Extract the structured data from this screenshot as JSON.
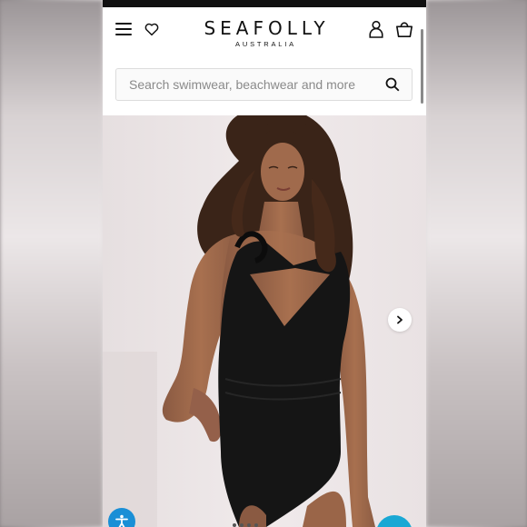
{
  "brand": {
    "name": "SEAFOLLY",
    "subtitle": "AUSTRALIA"
  },
  "search": {
    "placeholder": "Search swimwear, beachwear and more"
  },
  "icons": {
    "menu": "hamburger-menu-icon",
    "wishlist": "heart-icon",
    "account": "user-icon",
    "cart": "shopping-bag-icon",
    "search": "search-icon",
    "next": "chevron-right-icon",
    "accessibility": "accessibility-icon",
    "chat": "chat-icon"
  },
  "product": {
    "image_description": "Model wearing black one-shoulder twist cut-out one-piece swimsuit"
  },
  "colors": {
    "accessibility_button": "#1a8fd6",
    "chat_button": "#1aa8d4",
    "swimsuit": "#151515"
  }
}
